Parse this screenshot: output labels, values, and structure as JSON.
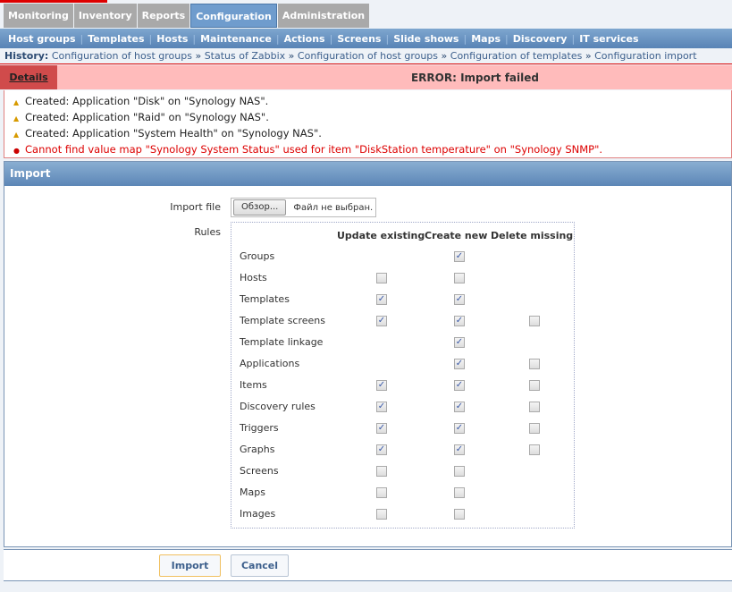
{
  "tabs": [
    "Monitoring",
    "Inventory",
    "Reports",
    "Configuration",
    "Administration"
  ],
  "active_tab": 3,
  "subnav": [
    "Host groups",
    "Templates",
    "Hosts",
    "Maintenance",
    "Actions",
    "Screens",
    "Slide shows",
    "Maps",
    "Discovery",
    "IT services"
  ],
  "history": {
    "label": "History:",
    "items": [
      "Configuration of host groups",
      "Status of Zabbix",
      "Configuration of host groups",
      "Configuration of templates",
      "Configuration import"
    ]
  },
  "error": {
    "details_label": "Details",
    "title": "ERROR: Import failed"
  },
  "messages": [
    {
      "type": "warning",
      "text": "Created: Application \"Disk\" on \"Synology NAS\"."
    },
    {
      "type": "warning",
      "text": "Created: Application \"Raid\" on \"Synology NAS\"."
    },
    {
      "type": "warning",
      "text": "Created: Application \"System Health\" on \"Synology NAS\"."
    },
    {
      "type": "error",
      "text": "Cannot find value map \"Synology System Status\" used for item \"DiskStation temperature\" on \"Synology SNMP\"."
    }
  ],
  "import": {
    "title": "Import",
    "file_label": "Import file",
    "browse_label": "Обзор...",
    "no_file": "Файл не выбран.",
    "rules_label": "Rules",
    "columns": [
      "Update existing",
      "Create new",
      "Delete missing"
    ],
    "rules": [
      {
        "name": "Groups",
        "update": null,
        "create": true,
        "delete": null
      },
      {
        "name": "Hosts",
        "update": false,
        "create": false,
        "delete": null
      },
      {
        "name": "Templates",
        "update": true,
        "create": true,
        "delete": null
      },
      {
        "name": "Template screens",
        "update": true,
        "create": true,
        "delete": false
      },
      {
        "name": "Template linkage",
        "update": null,
        "create": true,
        "delete": null
      },
      {
        "name": "Applications",
        "update": null,
        "create": true,
        "delete": false
      },
      {
        "name": "Items",
        "update": true,
        "create": true,
        "delete": false
      },
      {
        "name": "Discovery rules",
        "update": true,
        "create": true,
        "delete": false
      },
      {
        "name": "Triggers",
        "update": true,
        "create": true,
        "delete": false
      },
      {
        "name": "Graphs",
        "update": true,
        "create": true,
        "delete": false
      },
      {
        "name": "Screens",
        "update": false,
        "create": false,
        "delete": null
      },
      {
        "name": "Maps",
        "update": false,
        "create": false,
        "delete": null
      },
      {
        "name": "Images",
        "update": false,
        "create": false,
        "delete": null
      }
    ],
    "import_button": "Import",
    "cancel_button": "Cancel"
  }
}
